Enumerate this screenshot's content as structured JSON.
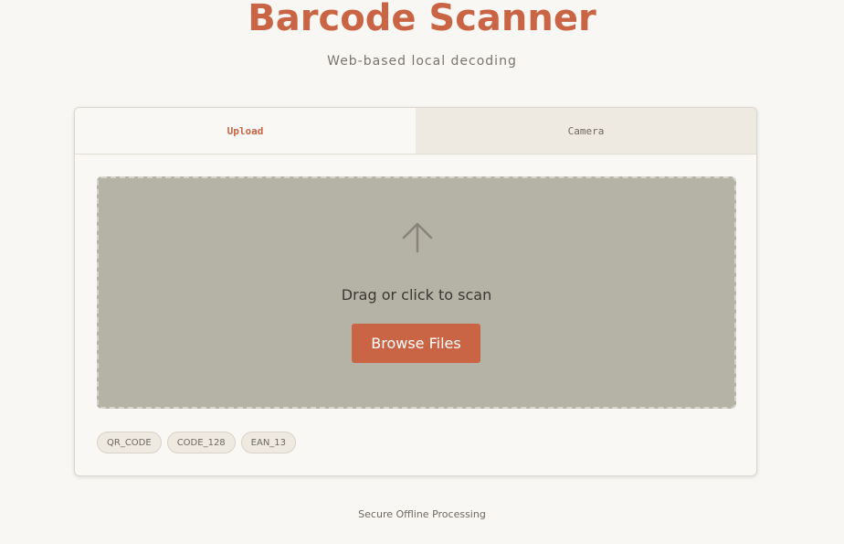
{
  "header": {
    "title": "Barcode Scanner",
    "subtitle": "Web-based local decoding"
  },
  "tabs": [
    {
      "label": "Upload",
      "active": true
    },
    {
      "label": "Camera",
      "active": false
    }
  ],
  "dropzone": {
    "icon": "upload-arrow-icon",
    "prompt": "Drag or click to scan",
    "button_label": "Browse Files"
  },
  "formats": [
    "QR_CODE",
    "CODE_128",
    "EAN_13"
  ],
  "footer": {
    "text": "Secure Offline Processing"
  },
  "colors": {
    "accent": "#c96444",
    "background": "#f9f7f4",
    "dropzone": "#b5b2a6",
    "inactive_tab": "#eeeae1"
  }
}
